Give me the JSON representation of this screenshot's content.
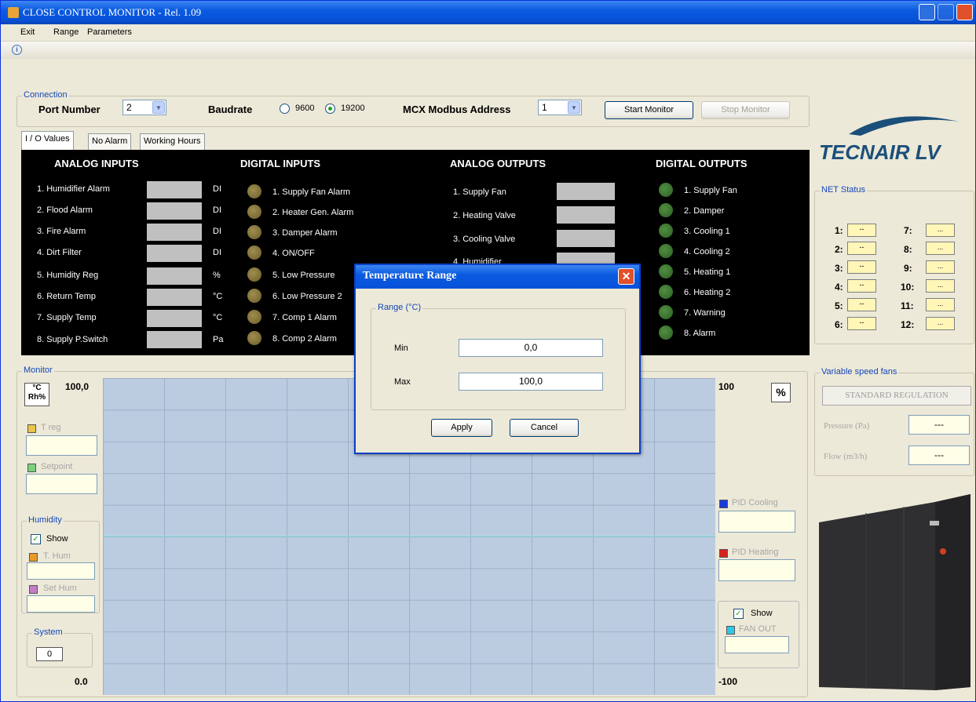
{
  "window": {
    "title": "CLOSE CONTROL MONITOR  -  Rel. 1.09"
  },
  "menu": [
    "Exit",
    "Range",
    "Parameters"
  ],
  "toolbar": {
    "info_icon": "info-icon"
  },
  "connection": {
    "group_label": "Connection",
    "port_label": "Port Number",
    "port_value": "2",
    "baud_label": "Baudrate",
    "baud_9600": "9600",
    "baud_19200": "19200",
    "baud_selected": "19200",
    "mcx_label": "MCX Modbus Address",
    "mcx_value": "1",
    "start_label": "Start Monitor",
    "stop_label": "Stop Monitor"
  },
  "tabs": [
    "I / O Values",
    "No Alarm",
    "Working Hours"
  ],
  "analog_inputs": {
    "title": "ANALOG INPUTS",
    "items": [
      {
        "label": "1. Humidifier Alarm",
        "unit": "DI"
      },
      {
        "label": "2. Flood Alarm",
        "unit": "DI"
      },
      {
        "label": "3. Fire Alarm",
        "unit": "DI"
      },
      {
        "label": "4. Dirt Filter",
        "unit": "DI"
      },
      {
        "label": "5. Humidity Reg",
        "unit": "%"
      },
      {
        "label": "6. Return Temp",
        "unit": "°C"
      },
      {
        "label": "7. Supply Temp",
        "unit": "°C"
      },
      {
        "label": "8. Supply P.Switch",
        "unit": "Pa"
      }
    ]
  },
  "digital_inputs": {
    "title": "DIGITAL INPUTS",
    "items": [
      "1. Supply Fan Alarm",
      "2. Heater Gen. Alarm",
      "3. Damper Alarm",
      "4. ON/OFF",
      "5. Low Pressure",
      "6. Low Pressure 2",
      "7. Comp 1 Alarm",
      "8. Comp 2 Alarm"
    ]
  },
  "analog_outputs": {
    "title": "ANALOG OUTPUTS",
    "items": [
      "1. Supply Fan",
      "2. Heating Valve",
      "3. Cooling Valve",
      "4. Humidifier"
    ]
  },
  "digital_outputs": {
    "title": "DIGITAL OUTPUTS",
    "items": [
      "1. Supply Fan",
      "2. Damper",
      "3. Cooling 1",
      "4. Cooling 2",
      "5. Heating 1",
      "6. Heating 2",
      "7. Warning",
      "8. Alarm"
    ]
  },
  "brand": {
    "name": "TECNAIR LV"
  },
  "net_status": {
    "label": "NET Status",
    "left": [
      "1:",
      "2:",
      "3:",
      "4:",
      "5:",
      "6:"
    ],
    "right": [
      "7:",
      "8:",
      "9:",
      "10:",
      "11:",
      "12:"
    ],
    "left_val": "--",
    "right_val": "..."
  },
  "monitor": {
    "label": "Monitor",
    "unit_toggle": "°C\nRh%",
    "y_top": "100,0",
    "y_bottom": "0.0",
    "right_top": "100",
    "right_bottom": "-100",
    "percent": "%",
    "t_reg": "T reg",
    "setpoint": "Setpoint",
    "humidity_label": "Humidity",
    "show": "Show",
    "t_hum": "T. Hum",
    "set_hum": "Set Hum",
    "system_label": "System",
    "system_value": "0",
    "pid_cooling": "PID Cooling",
    "pid_heating": "PID Heating",
    "fan_show": "Show",
    "fan_out": "FAN OUT"
  },
  "vsf": {
    "label": "Variable speed fans",
    "mode": "STANDARD REGULATION",
    "pressure": "Pressure (Pa)",
    "flow": "Flow (m3/h)",
    "pressure_val": "---",
    "flow_val": "---"
  },
  "dialog": {
    "title": "Temperature Range",
    "group": "Range (°C)",
    "min_label": "Min",
    "max_label": "Max",
    "min_value": "0,0",
    "max_value": "100,0",
    "apply": "Apply",
    "cancel": "Cancel"
  },
  "colors": {
    "t_reg": "#E8C44A",
    "setpoint": "#7CD07C",
    "t_hum": "#E89A2A",
    "set_hum": "#C47BC8",
    "pid_cooling": "#1A3BD8",
    "pid_heating": "#D82020",
    "fan_out": "#2EC8E8",
    "line": "#88E8E0"
  }
}
